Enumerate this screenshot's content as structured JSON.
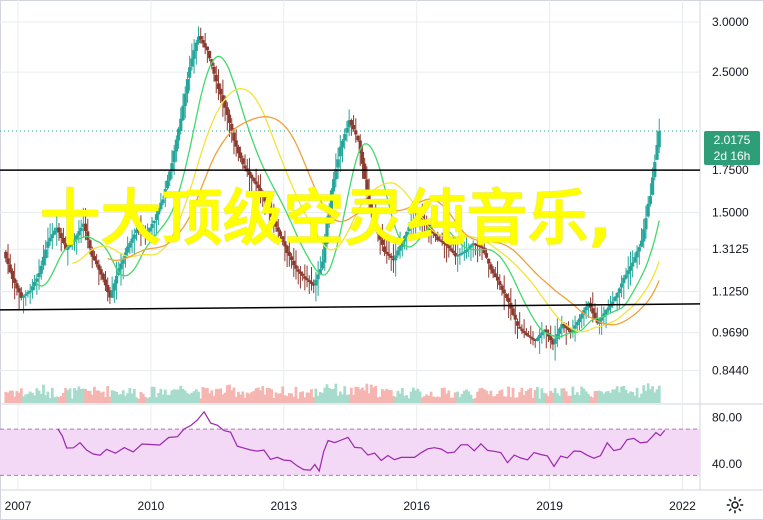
{
  "overlay": {
    "title": "十大顶级空灵纯音乐,"
  },
  "price_tag": {
    "price": "2.0175",
    "timeframe": "2d 16h"
  },
  "icons": {
    "settings": "gear-icon"
  },
  "colors": {
    "up": "#26a69a",
    "down": "#8b3a2f",
    "ma_green": "#43d96b",
    "ma_yellow": "#f2e33a",
    "ma_orange": "#f0a03c",
    "rsi_line": "#9c27b0",
    "rsi_band": "#f3d9f5",
    "volume_red": "#f5b5b0",
    "volume_green": "#a7dccc",
    "grid": "#e9ecef",
    "title": "#ffff00"
  },
  "chart_data": {
    "type": "candlestick",
    "price_axis_ticks": [
      "3.0000",
      "2.5000",
      "1.7500",
      "1.5000",
      "1.3125",
      "1.1250",
      "0.9690",
      "0.8440"
    ],
    "rsi_axis_ticks": [
      "80.00",
      "40.00"
    ],
    "time_axis_ticks": [
      "2007",
      "2010",
      "2013",
      "2016",
      "2019",
      "2022"
    ],
    "last_price": 2.0175,
    "support_resistance": [
      1.75,
      1.06
    ],
    "rsi_band": [
      70,
      30
    ],
    "price_path": [
      [
        2006.7,
        1.3
      ],
      [
        2006.9,
        1.18
      ],
      [
        2007.1,
        1.1
      ],
      [
        2007.3,
        1.13
      ],
      [
        2007.5,
        1.2
      ],
      [
        2007.7,
        1.35
      ],
      [
        2007.9,
        1.42
      ],
      [
        2008.1,
        1.31
      ],
      [
        2008.3,
        1.36
      ],
      [
        2008.5,
        1.44
      ],
      [
        2008.7,
        1.28
      ],
      [
        2008.9,
        1.2
      ],
      [
        2009.1,
        1.1
      ],
      [
        2009.3,
        1.22
      ],
      [
        2009.5,
        1.32
      ],
      [
        2009.7,
        1.41
      ],
      [
        2009.9,
        1.38
      ],
      [
        2010.1,
        1.46
      ],
      [
        2010.3,
        1.58
      ],
      [
        2010.5,
        1.8
      ],
      [
        2010.7,
        2.1
      ],
      [
        2010.9,
        2.55
      ],
      [
        2011.1,
        2.85
      ],
      [
        2011.3,
        2.7
      ],
      [
        2011.5,
        2.4
      ],
      [
        2011.7,
        2.2
      ],
      [
        2011.9,
        1.95
      ],
      [
        2012.1,
        1.78
      ],
      [
        2012.3,
        1.7
      ],
      [
        2012.5,
        1.62
      ],
      [
        2012.7,
        1.5
      ],
      [
        2012.9,
        1.4
      ],
      [
        2013.1,
        1.3
      ],
      [
        2013.3,
        1.22
      ],
      [
        2013.5,
        1.18
      ],
      [
        2013.7,
        1.15
      ],
      [
        2013.9,
        1.25
      ],
      [
        2014.1,
        1.62
      ],
      [
        2014.3,
        1.9
      ],
      [
        2014.5,
        2.1
      ],
      [
        2014.7,
        1.95
      ],
      [
        2014.9,
        1.62
      ],
      [
        2015.1,
        1.42
      ],
      [
        2015.3,
        1.3
      ],
      [
        2015.5,
        1.26
      ],
      [
        2015.7,
        1.35
      ],
      [
        2015.9,
        1.45
      ],
      [
        2016.1,
        1.48
      ],
      [
        2016.3,
        1.42
      ],
      [
        2016.5,
        1.36
      ],
      [
        2016.7,
        1.33
      ],
      [
        2016.9,
        1.28
      ],
      [
        2017.1,
        1.3
      ],
      [
        2017.3,
        1.34
      ],
      [
        2017.5,
        1.32
      ],
      [
        2017.7,
        1.22
      ],
      [
        2017.9,
        1.15
      ],
      [
        2018.1,
        1.08
      ],
      [
        2018.3,
        0.99
      ],
      [
        2018.5,
        0.96
      ],
      [
        2018.7,
        0.94
      ],
      [
        2018.9,
        0.98
      ],
      [
        2019.1,
        0.93
      ],
      [
        2019.3,
        1.0
      ],
      [
        2019.5,
        0.97
      ],
      [
        2019.7,
        1.02
      ],
      [
        2019.9,
        1.08
      ],
      [
        2020.1,
        1.0
      ],
      [
        2020.3,
        1.05
      ],
      [
        2020.5,
        1.1
      ],
      [
        2020.7,
        1.18
      ],
      [
        2020.9,
        1.25
      ],
      [
        2021.1,
        1.35
      ],
      [
        2021.3,
        1.6
      ],
      [
        2021.5,
        2.0175
      ]
    ],
    "rsi_path": [
      [
        2007.9,
        71
      ],
      [
        2008.1,
        52
      ],
      [
        2008.4,
        56
      ],
      [
        2008.7,
        48
      ],
      [
        2009.0,
        55
      ],
      [
        2009.4,
        52
      ],
      [
        2009.8,
        58
      ],
      [
        2010.2,
        55
      ],
      [
        2010.6,
        63
      ],
      [
        2010.9,
        76
      ],
      [
        2011.2,
        82
      ],
      [
        2011.5,
        74
      ],
      [
        2011.8,
        65
      ],
      [
        2012.1,
        55
      ],
      [
        2012.4,
        50
      ],
      [
        2012.7,
        45
      ],
      [
        2013.0,
        41
      ],
      [
        2013.3,
        37
      ],
      [
        2013.6,
        34
      ],
      [
        2013.8,
        36
      ],
      [
        2014.0,
        58
      ],
      [
        2014.3,
        63
      ],
      [
        2014.6,
        55
      ],
      [
        2014.9,
        48
      ],
      [
        2015.2,
        45
      ],
      [
        2015.5,
        41
      ],
      [
        2015.8,
        44
      ],
      [
        2016.1,
        52
      ],
      [
        2016.4,
        56
      ],
      [
        2016.7,
        51
      ],
      [
        2017.0,
        58
      ],
      [
        2017.3,
        52
      ],
      [
        2017.6,
        54
      ],
      [
        2017.9,
        47
      ],
      [
        2018.2,
        45
      ],
      [
        2018.5,
        42
      ],
      [
        2018.8,
        48
      ],
      [
        2019.1,
        40
      ],
      [
        2019.4,
        45
      ],
      [
        2019.7,
        52
      ],
      [
        2020.0,
        46
      ],
      [
        2020.3,
        57
      ],
      [
        2020.6,
        52
      ],
      [
        2020.9,
        60
      ],
      [
        2021.2,
        58
      ],
      [
        2021.4,
        65
      ],
      [
        2021.6,
        72
      ]
    ]
  }
}
